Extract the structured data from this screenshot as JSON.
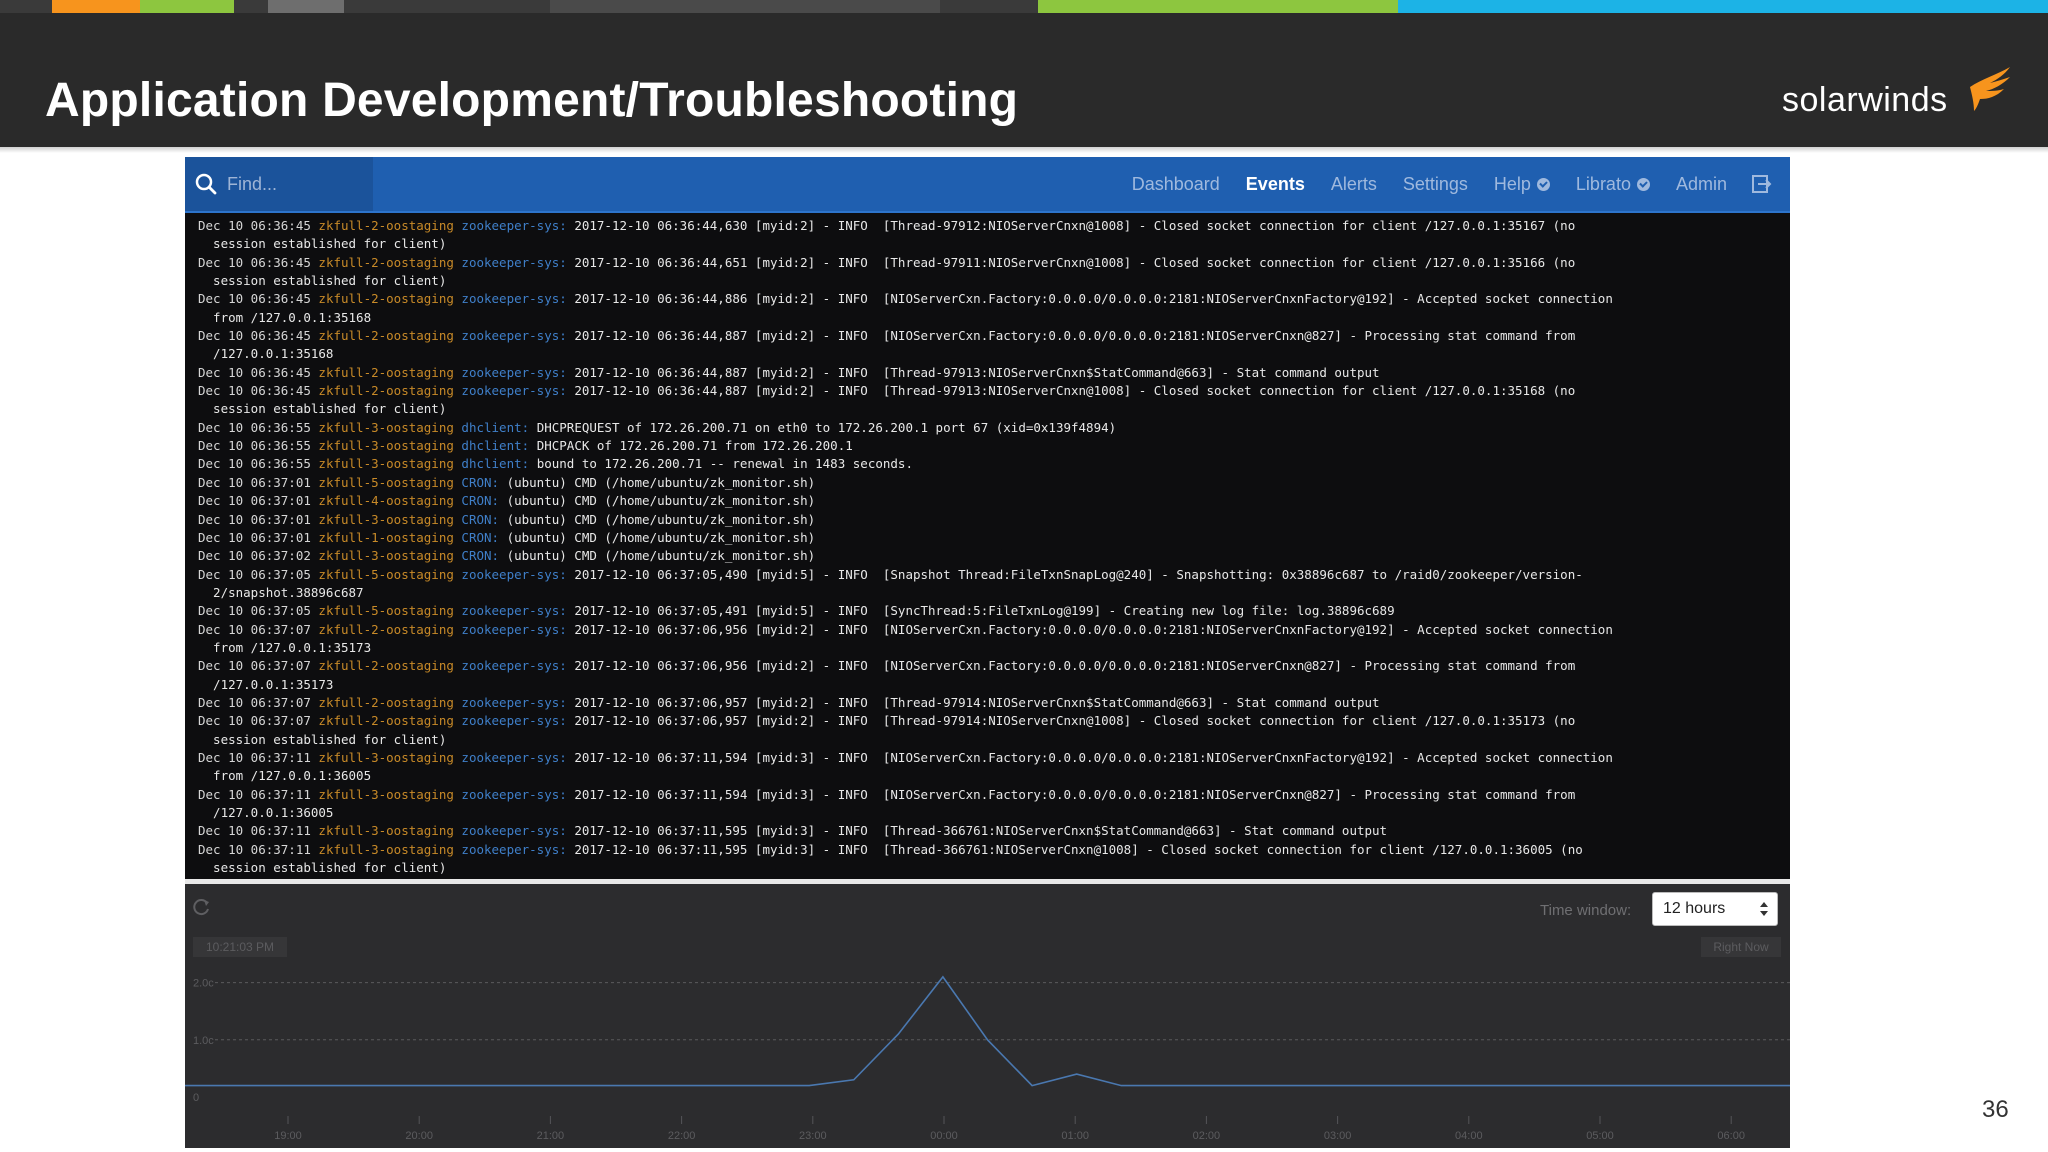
{
  "slide": {
    "title": "Application Development/Troubleshooting",
    "page_number": "36",
    "color_strip": [
      "#3a3a3a",
      "#f7941d",
      "#8dc63f",
      "#3a3a3a",
      "#6e6e6e",
      "#3a3a3a",
      "#4a4a4a",
      "#3a3a3a",
      "#8dc63f",
      "#1cb3e6"
    ]
  },
  "logo": {
    "text": "solarwinds",
    "icon": "solarwinds-bird-icon",
    "color": "#f7941d"
  },
  "nav": {
    "search_placeholder": "Find...",
    "items": [
      {
        "label": "Dashboard",
        "active": false
      },
      {
        "label": "Events",
        "active": true
      },
      {
        "label": "Alerts",
        "active": false
      },
      {
        "label": "Settings",
        "active": false
      },
      {
        "label": "Help",
        "active": false,
        "badge": true
      },
      {
        "label": "Librato",
        "active": false,
        "badge": true
      },
      {
        "label": "Admin",
        "active": false
      }
    ],
    "accent": "#1f5fb0"
  },
  "log_lines": [
    {
      "ts": "Dec 10 06:36:45 ",
      "host": "zkfull-2-oostaging ",
      "prog": "zookeeper-sys: ",
      "msg": "2017-12-10 06:36:44,630 [myid:2] - INFO  [Thread-97912:NIOServerCnxn@1008] - Closed socket connection for client /127.0.0.1:35167 (no"
    },
    {
      "ts": "",
      "host": "",
      "prog": "",
      "msg": "  session established for client)"
    },
    {
      "ts": "Dec 10 06:36:45 ",
      "host": "zkfull-2-oostaging ",
      "prog": "zookeeper-sys: ",
      "msg": "2017-12-10 06:36:44,651 [myid:2] - INFO  [Thread-97911:NIOServerCnxn@1008] - Closed socket connection for client /127.0.0.1:35166 (no"
    },
    {
      "ts": "",
      "host": "",
      "prog": "",
      "msg": "  session established for client)"
    },
    {
      "ts": "Dec 10 06:36:45 ",
      "host": "zkfull-2-oostaging ",
      "prog": "zookeeper-sys: ",
      "msg": "2017-12-10 06:36:44,886 [myid:2] - INFO  [NIOServerCxn.Factory:0.0.0.0/0.0.0.0:2181:NIOServerCnxnFactory@192] - Accepted socket connection"
    },
    {
      "ts": "",
      "host": "",
      "prog": "",
      "msg": "  from /127.0.0.1:35168"
    },
    {
      "ts": "Dec 10 06:36:45 ",
      "host": "zkfull-2-oostaging ",
      "prog": "zookeeper-sys: ",
      "msg": "2017-12-10 06:36:44,887 [myid:2] - INFO  [NIOServerCxn.Factory:0.0.0.0/0.0.0.0:2181:NIOServerCnxn@827] - Processing stat command from"
    },
    {
      "ts": "",
      "host": "",
      "prog": "",
      "msg": "  /127.0.0.1:35168"
    },
    {
      "ts": "Dec 10 06:36:45 ",
      "host": "zkfull-2-oostaging ",
      "prog": "zookeeper-sys: ",
      "msg": "2017-12-10 06:36:44,887 [myid:2] - INFO  [Thread-97913:NIOServerCnxn$StatCommand@663] - Stat command output"
    },
    {
      "ts": "Dec 10 06:36:45 ",
      "host": "zkfull-2-oostaging ",
      "prog": "zookeeper-sys: ",
      "msg": "2017-12-10 06:36:44,887 [myid:2] - INFO  [Thread-97913:NIOServerCnxn@1008] - Closed socket connection for client /127.0.0.1:35168 (no"
    },
    {
      "ts": "",
      "host": "",
      "prog": "",
      "msg": "  session established for client)"
    },
    {
      "ts": "Dec 10 06:36:55 ",
      "host": "zkfull-3-oostaging ",
      "prog": "dhclient: ",
      "msg": "DHCPREQUEST of 172.26.200.71 on eth0 to 172.26.200.1 port 67 (xid=0x139f4894)"
    },
    {
      "ts": "Dec 10 06:36:55 ",
      "host": "zkfull-3-oostaging ",
      "prog": "dhclient: ",
      "msg": "DHCPACK of 172.26.200.71 from 172.26.200.1"
    },
    {
      "ts": "Dec 10 06:36:55 ",
      "host": "zkfull-3-oostaging ",
      "prog": "dhclient: ",
      "msg": "bound to 172.26.200.71 -- renewal in 1483 seconds."
    },
    {
      "ts": "Dec 10 06:37:01 ",
      "host": "zkfull-5-oostaging ",
      "prog": "CRON: ",
      "msg": "(ubuntu) CMD (/home/ubuntu/zk_monitor.sh)"
    },
    {
      "ts": "Dec 10 06:37:01 ",
      "host": "zkfull-4-oostaging ",
      "prog": "CRON: ",
      "msg": "(ubuntu) CMD (/home/ubuntu/zk_monitor.sh)"
    },
    {
      "ts": "Dec 10 06:37:01 ",
      "host": "zkfull-3-oostaging ",
      "prog": "CRON: ",
      "msg": "(ubuntu) CMD (/home/ubuntu/zk_monitor.sh)"
    },
    {
      "ts": "Dec 10 06:37:01 ",
      "host": "zkfull-1-oostaging ",
      "prog": "CRON: ",
      "msg": "(ubuntu) CMD (/home/ubuntu/zk_monitor.sh)"
    },
    {
      "ts": "Dec 10 06:37:02 ",
      "host": "zkfull-3-oostaging ",
      "prog": "CRON: ",
      "msg": "(ubuntu) CMD (/home/ubuntu/zk_monitor.sh)"
    },
    {
      "ts": "Dec 10 06:37:05 ",
      "host": "zkfull-5-oostaging ",
      "prog": "zookeeper-sys: ",
      "msg": "2017-12-10 06:37:05,490 [myid:5] - INFO  [Snapshot Thread:FileTxnSnapLog@240] - Snapshotting: 0x38896c687 to /raid0/zookeeper/version-"
    },
    {
      "ts": "",
      "host": "",
      "prog": "",
      "msg": "  2/snapshot.38896c687"
    },
    {
      "ts": "Dec 10 06:37:05 ",
      "host": "zkfull-5-oostaging ",
      "prog": "zookeeper-sys: ",
      "msg": "2017-12-10 06:37:05,491 [myid:5] - INFO  [SyncThread:5:FileTxnLog@199] - Creating new log file: log.38896c689"
    },
    {
      "ts": "Dec 10 06:37:07 ",
      "host": "zkfull-2-oostaging ",
      "prog": "zookeeper-sys: ",
      "msg": "2017-12-10 06:37:06,956 [myid:2] - INFO  [NIOServerCxn.Factory:0.0.0.0/0.0.0.0:2181:NIOServerCnxnFactory@192] - Accepted socket connection"
    },
    {
      "ts": "",
      "host": "",
      "prog": "",
      "msg": "  from /127.0.0.1:35173"
    },
    {
      "ts": "Dec 10 06:37:07 ",
      "host": "zkfull-2-oostaging ",
      "prog": "zookeeper-sys: ",
      "msg": "2017-12-10 06:37:06,956 [myid:2] - INFO  [NIOServerCxn.Factory:0.0.0.0/0.0.0.0:2181:NIOServerCnxn@827] - Processing stat command from"
    },
    {
      "ts": "",
      "host": "",
      "prog": "",
      "msg": "  /127.0.0.1:35173"
    },
    {
      "ts": "Dec 10 06:37:07 ",
      "host": "zkfull-2-oostaging ",
      "prog": "zookeeper-sys: ",
      "msg": "2017-12-10 06:37:06,957 [myid:2] - INFO  [Thread-97914:NIOServerCnxn$StatCommand@663] - Stat command output"
    },
    {
      "ts": "Dec 10 06:37:07 ",
      "host": "zkfull-2-oostaging ",
      "prog": "zookeeper-sys: ",
      "msg": "2017-12-10 06:37:06,957 [myid:2] - INFO  [Thread-97914:NIOServerCnxn@1008] - Closed socket connection for client /127.0.0.1:35173 (no"
    },
    {
      "ts": "",
      "host": "",
      "prog": "",
      "msg": "  session established for client)"
    },
    {
      "ts": "Dec 10 06:37:11 ",
      "host": "zkfull-3-oostaging ",
      "prog": "zookeeper-sys: ",
      "msg": "2017-12-10 06:37:11,594 [myid:3] - INFO  [NIOServerCxn.Factory:0.0.0.0/0.0.0.0:2181:NIOServerCnxnFactory@192] - Accepted socket connection"
    },
    {
      "ts": "",
      "host": "",
      "prog": "",
      "msg": "  from /127.0.0.1:36005"
    },
    {
      "ts": "Dec 10 06:37:11 ",
      "host": "zkfull-3-oostaging ",
      "prog": "zookeeper-sys: ",
      "msg": "2017-12-10 06:37:11,594 [myid:3] - INFO  [NIOServerCxn.Factory:0.0.0.0/0.0.0.0:2181:NIOServerCnxn@827] - Processing stat command from"
    },
    {
      "ts": "",
      "host": "",
      "prog": "",
      "msg": "  /127.0.0.1:36005"
    },
    {
      "ts": "Dec 10 06:37:11 ",
      "host": "zkfull-3-oostaging ",
      "prog": "zookeeper-sys: ",
      "msg": "2017-12-10 06:37:11,595 [myid:3] - INFO  [Thread-366761:NIOServerCnxn$StatCommand@663] - Stat command output"
    },
    {
      "ts": "Dec 10 06:37:11 ",
      "host": "zkfull-3-oostaging ",
      "prog": "zookeeper-sys: ",
      "msg": "2017-12-10 06:37:11,595 [myid:3] - INFO  [Thread-366761:NIOServerCnxn@1008] - Closed socket connection for client /127.0.0.1:36005 (no"
    },
    {
      "ts": "",
      "host": "",
      "prog": "",
      "msg": "  session established for client)"
    }
  ],
  "time_window": {
    "label": "Time window:",
    "value": "12 hours"
  },
  "chart_tags": {
    "left": "10:21:03 PM",
    "right": "Right Now"
  },
  "chart_data": {
    "type": "line",
    "x": [
      "19:00",
      "19:20",
      "19:40",
      "20:00",
      "20:20",
      "20:40",
      "21:00",
      "21:20",
      "21:40",
      "22:00",
      "22:20",
      "22:40",
      "23:00",
      "23:20",
      "23:40",
      "00:00",
      "00:10",
      "00:20",
      "00:30",
      "00:40",
      "01:00",
      "01:20",
      "01:40",
      "02:00",
      "02:20",
      "02:40",
      "03:00",
      "03:20",
      "03:40",
      "04:00",
      "04:20",
      "04:40",
      "05:00",
      "05:20",
      "05:40",
      "06:00",
      "06:20"
    ],
    "series": [
      {
        "values": [
          0.2,
          0.2,
          0.2,
          0.2,
          0.2,
          0.2,
          0.2,
          0.2,
          0.2,
          0.2,
          0.2,
          0.2,
          0.2,
          0.2,
          0.2,
          0.3,
          1.1,
          2.1,
          1.0,
          0.2,
          0.4,
          0.2,
          0.2,
          0.2,
          0.2,
          0.2,
          0.2,
          0.2,
          0.2,
          0.2,
          0.2,
          0.2,
          0.2,
          0.2,
          0.2,
          0.2,
          0.2
        ]
      }
    ],
    "x_ticks": [
      "19:00",
      "20:00",
      "21:00",
      "22:00",
      "23:00",
      "00:00",
      "01:00",
      "02:00",
      "03:00",
      "04:00",
      "05:00",
      "06:00"
    ],
    "y_ticks": [
      "0",
      "1.0c",
      "2.0c"
    ],
    "ylim": [
      0,
      2.5
    ],
    "grid": true,
    "line_color": "#4a78b0"
  }
}
